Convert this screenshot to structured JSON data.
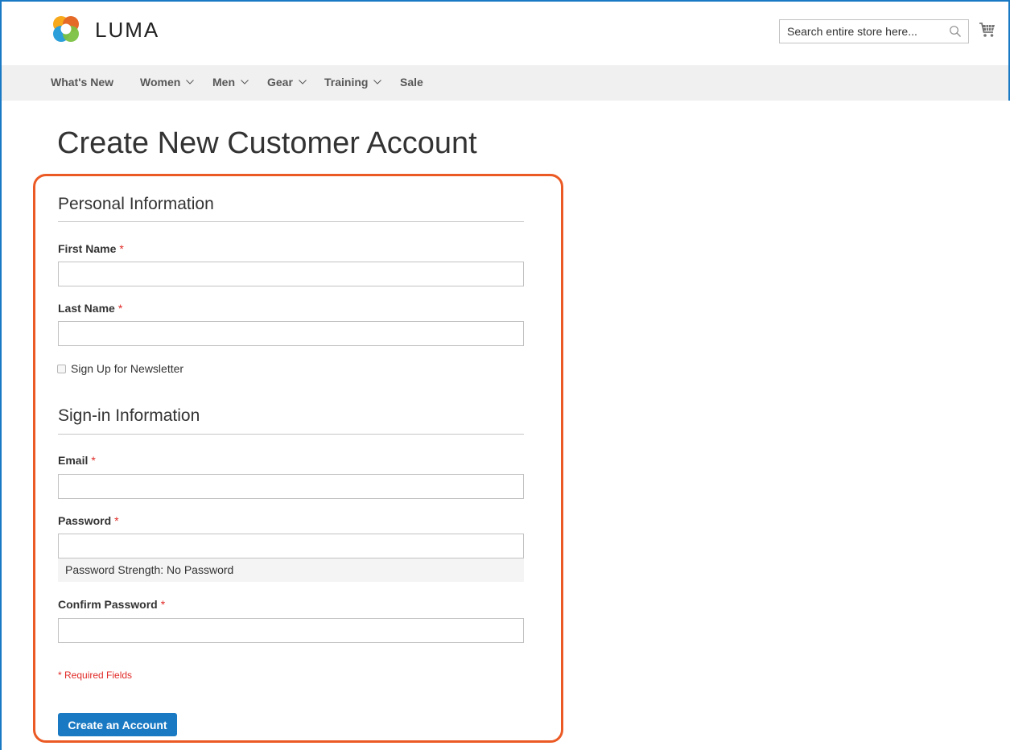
{
  "header": {
    "logo_text": "LUMA",
    "search_placeholder": "Search entire store here...",
    "icons": {
      "search": "search-icon",
      "cart": "cart-icon",
      "logo": "luma-logo-icon"
    }
  },
  "nav": {
    "items": [
      {
        "label": "What's New",
        "has_dropdown": false
      },
      {
        "label": "Women",
        "has_dropdown": true
      },
      {
        "label": "Men",
        "has_dropdown": true
      },
      {
        "label": "Gear",
        "has_dropdown": true
      },
      {
        "label": "Training",
        "has_dropdown": true
      },
      {
        "label": "Sale",
        "has_dropdown": false
      }
    ]
  },
  "page": {
    "title": "Create New Customer Account"
  },
  "form": {
    "personal": {
      "title": "Personal Information",
      "first_name_label": "First Name",
      "last_name_label": "Last Name",
      "newsletter_label": "Sign Up for Newsletter"
    },
    "signin": {
      "title": "Sign-in Information",
      "email_label": "Email",
      "password_label": "Password",
      "password_strength": "Password Strength: No Password",
      "confirm_password_label": "Confirm Password"
    },
    "required_marker": "*",
    "required_note": "* Required Fields",
    "submit_label": "Create an Account"
  },
  "colors": {
    "accent_blue": "#1979c3",
    "highlight_orange": "#eb5a24",
    "required_red": "#e02b27",
    "nav_bg": "#f0f0f0"
  }
}
